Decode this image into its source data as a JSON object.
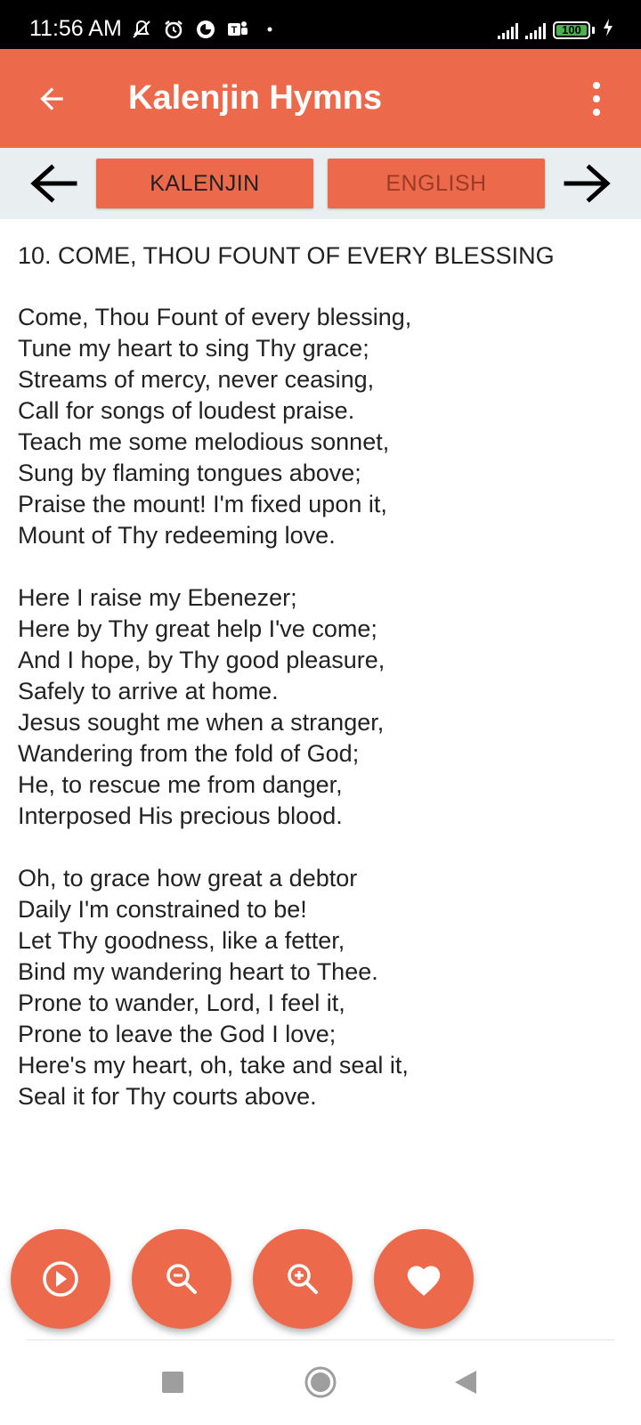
{
  "status_bar": {
    "time": "11:56 AM",
    "battery": "100",
    "icons": [
      "mute-icon",
      "alarm-icon",
      "data-saver-icon",
      "teams-icon",
      "dot-icon",
      "signal-icon",
      "signal-icon",
      "battery-icon",
      "charging-icon"
    ]
  },
  "app_bar": {
    "title": "Kalenjin Hymns",
    "back_icon": "arrow-left-icon",
    "menu_icon": "more-vert-icon"
  },
  "language_bar": {
    "prev_icon": "arrow-left-icon",
    "next_icon": "arrow-right-icon",
    "kalenjin_label": "KALENJIN",
    "english_label": "ENGLISH"
  },
  "hymn": {
    "title": "10. COME, THOU FOUNT OF EVERY BLESSING",
    "stanzas": [
      [
        "Come, Thou Fount of every blessing,",
        "Tune my heart to sing Thy grace;",
        "Streams of mercy, never ceasing,",
        "Call for songs of loudest praise.",
        "Teach me some melodious sonnet,",
        "Sung by flaming tongues above;",
        "Praise the mount! I'm fixed upon it,",
        "Mount of Thy redeeming love."
      ],
      [
        "Here I raise my Ebenezer;",
        "Here by Thy great help I've come;",
        "And I hope, by Thy good pleasure,",
        "Safely to arrive at home.",
        "Jesus sought me when a stranger,",
        "Wandering from the fold of God;",
        "He, to rescue me from danger,",
        "Interposed His precious blood."
      ],
      [
        "Oh, to grace how great a debtor",
        "Daily I'm constrained to be!",
        "Let Thy goodness, like a fetter,",
        "Bind my wandering heart to Thee.",
        "Prone to wander, Lord, I feel it,",
        "Prone to leave the God I love;",
        "Here's my heart, oh, take and seal it,",
        "Seal it for Thy courts above."
      ]
    ]
  },
  "fabs": [
    "play-icon",
    "zoom-out-icon",
    "zoom-in-icon",
    "heart-icon"
  ],
  "nav_bar": [
    "recents-icon",
    "home-icon",
    "back-triangle-icon"
  ],
  "colors": {
    "accent": "#ec6a4b",
    "language_bar_bg": "#e9eef0",
    "text": "#222222",
    "english_label": "#9b3a25"
  }
}
